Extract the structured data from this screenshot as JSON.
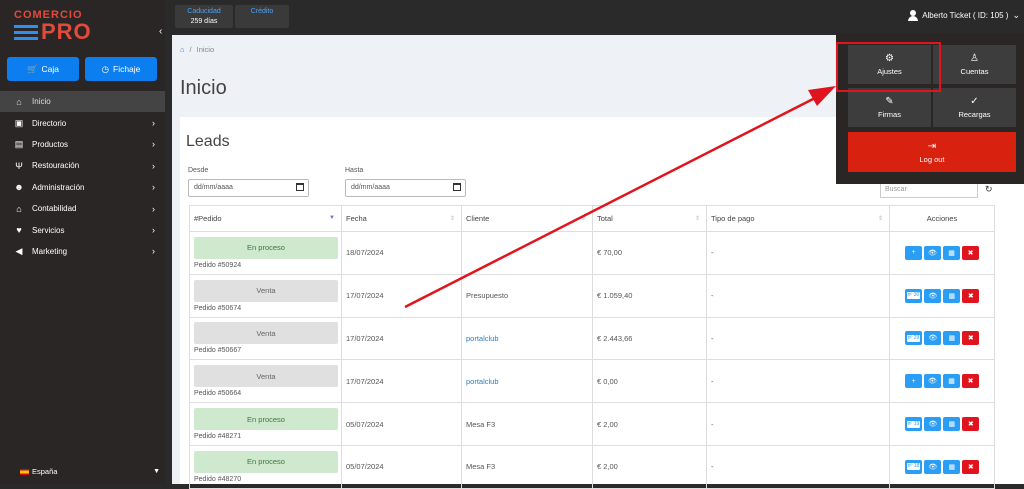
{
  "brand": {
    "top": "COMERCIO",
    "bottom": "PRO"
  },
  "sidebar": {
    "caja_label": "Caja",
    "fichaje_label": "Fichaje",
    "items": [
      {
        "label": "Inicio",
        "icon": "home-icon"
      },
      {
        "label": "Directorio",
        "icon": "address-book-icon"
      },
      {
        "label": "Productos",
        "icon": "box-icon"
      },
      {
        "label": "Restouración",
        "icon": "utensils-icon"
      },
      {
        "label": "Administración",
        "icon": "users-icon"
      },
      {
        "label": "Contabilidad",
        "icon": "bank-icon"
      },
      {
        "label": "Servicios",
        "icon": "handshake-icon"
      },
      {
        "label": "Marketing",
        "icon": "megaphone-icon"
      }
    ],
    "language": "España"
  },
  "topbar": {
    "caducidad_label": "Caducidad",
    "caducidad_value": "259 días",
    "credito_label": "Crédito",
    "user": "Alberto Ticket ( ID: 105 )"
  },
  "breadcrumb": {
    "current": "Inicio"
  },
  "page": {
    "title": "Inicio"
  },
  "leads": {
    "title": "Leads",
    "desde_label": "Desde",
    "hasta_label": "Hasta",
    "date_placeholder": "dd/mm/aaaa",
    "search_placeholder": "Buscar",
    "columns": [
      "#Pedido",
      "Fecha",
      "Cliente",
      "Total",
      "Tipo de pago",
      "Acciones"
    ],
    "rows": [
      {
        "status": "En proceso",
        "status_type": "green",
        "order": "Pedido #50924",
        "fecha": "18/07/2024",
        "cliente": "",
        "cliente_link": false,
        "total": "€ 70,00",
        "pago": "-",
        "tag": ""
      },
      {
        "status": "Venta",
        "status_type": "gray",
        "order": "Pedido #50674",
        "fecha": "17/07/2024",
        "cliente": "Presupuesto",
        "cliente_link": false,
        "total": "€ 1.059,40",
        "pago": "-",
        "tag": "nº 30"
      },
      {
        "status": "Venta",
        "status_type": "gray",
        "order": "Pedido #50667",
        "fecha": "17/07/2024",
        "cliente": "portalclub",
        "cliente_link": true,
        "total": "€ 2.443,66",
        "pago": "-",
        "tag": "nº 29"
      },
      {
        "status": "Venta",
        "status_type": "gray",
        "order": "Pedido #50664",
        "fecha": "17/07/2024",
        "cliente": "portalclub",
        "cliente_link": true,
        "total": "€ 0,00",
        "pago": "-",
        "tag": ""
      },
      {
        "status": "En proceso",
        "status_type": "green",
        "order": "Pedido #48271",
        "fecha": "05/07/2024",
        "cliente": "Mesa F3",
        "cliente_link": false,
        "total": "€ 2,00",
        "pago": "-",
        "tag": "nº 19"
      },
      {
        "status": "En proceso",
        "status_type": "green",
        "order": "Pedido #48270",
        "fecha": "05/07/2024",
        "cliente": "Mesa F3",
        "cliente_link": false,
        "total": "€ 2,00",
        "pago": "-",
        "tag": "nº 18"
      }
    ]
  },
  "user_menu": {
    "ajustes": "Ajustes",
    "cuentas": "Cuentas",
    "firmas": "Firmas",
    "recargas": "Recargas",
    "logout": "Log out"
  },
  "colors": {
    "accent": "#0d7ef0",
    "brand_red": "#e24a3b",
    "logout_red": "#d8210f",
    "annotation_red": "#e0141e"
  }
}
